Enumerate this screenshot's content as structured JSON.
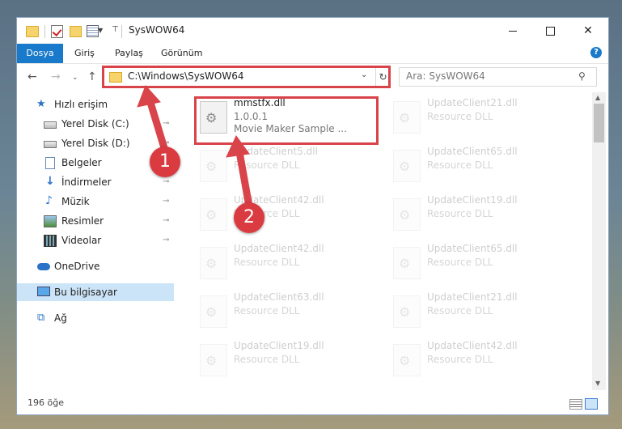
{
  "window": {
    "title": "SysWOW64",
    "controls": {
      "minimize": "—",
      "maximize": "□",
      "close": "✕"
    }
  },
  "ribbon": {
    "tabs": [
      "Dosya",
      "Giriş",
      "Paylaş",
      "Görünüm"
    ],
    "help": "?",
    "collapse": "⌄"
  },
  "nav": {
    "back": "←",
    "forward": "→",
    "recent": "⌄",
    "up": "↑",
    "address": "C:\\Windows\\SysWOW64",
    "address_dropdown": "⌄",
    "refresh": "↻",
    "search_placeholder": "Ara: SysWOW64",
    "search_icon": "⚲"
  },
  "sidebar": {
    "items": [
      {
        "label": "Hızlı erişim",
        "icon": "star-icon"
      },
      {
        "label": "Yerel Disk (C:)",
        "icon": "drive-icon",
        "pinned": true
      },
      {
        "label": "Yerel Disk (D:)",
        "icon": "drive-icon",
        "pinned": true
      },
      {
        "label": "Belgeler",
        "icon": "document-icon",
        "pinned": true
      },
      {
        "label": "İndirmeler",
        "icon": "download-icon",
        "pinned": true
      },
      {
        "label": "Müzik",
        "icon": "music-icon",
        "pinned": true
      },
      {
        "label": "Resimler",
        "icon": "pictures-icon",
        "pinned": true
      },
      {
        "label": "Videolar",
        "icon": "videos-icon",
        "pinned": true
      },
      {
        "label": "OneDrive",
        "icon": "cloud-icon"
      },
      {
        "label": "Bu bilgisayar",
        "icon": "computer-icon",
        "selected": true
      },
      {
        "label": "Ağ",
        "icon": "network-icon"
      }
    ],
    "pin_glyph": "📌"
  },
  "files": [
    {
      "name": "mmstfx.dll",
      "line2": "1.0.0.1",
      "line3": "Movie Maker Sample ...",
      "highlighted": true
    },
    {
      "name": "UpdateClient21.dll",
      "line2": "Resource DLL"
    },
    {
      "name": "UpdateClient5.dll",
      "line2": "Resource DLL"
    },
    {
      "name": "UpdateClient65.dll",
      "line2": "Resource DLL"
    },
    {
      "name": "UpdateClient42.dll",
      "line2": "Resource DLL"
    },
    {
      "name": "UpdateClient19.dll",
      "line2": "Resource DLL"
    },
    {
      "name": "UpdateClient42.dll",
      "line2": "Resource DLL"
    },
    {
      "name": "UpdateClient65.dll",
      "line2": "Resource DLL"
    },
    {
      "name": "UpdateClient63.dll",
      "line2": "Resource DLL"
    },
    {
      "name": "UpdateClient21.dll",
      "line2": "Resource DLL"
    },
    {
      "name": "UpdateClient19.dll",
      "line2": "Resource DLL"
    },
    {
      "name": "UpdateClient42.dll",
      "line2": "Resource DLL"
    }
  ],
  "status": {
    "item_count": "196 öğe"
  },
  "annotations": {
    "step1": "1",
    "step2": "2",
    "color": "#d9434a"
  }
}
